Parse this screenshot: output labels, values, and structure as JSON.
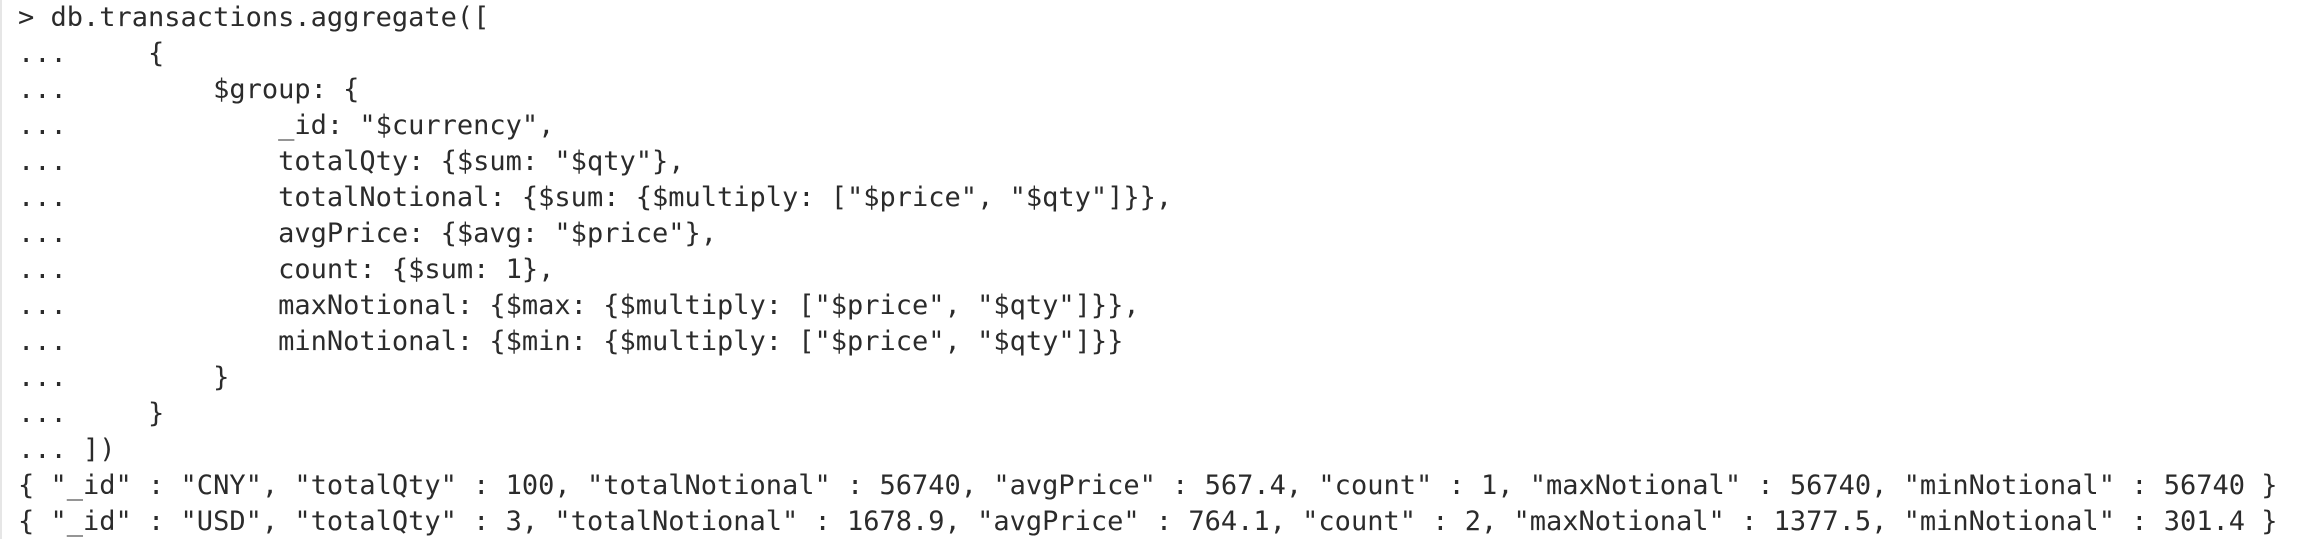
{
  "terminal": {
    "lines": [
      "> db.transactions.aggregate([",
      "...     {",
      "...         $group: {",
      "...             _id: \"$currency\",",
      "...             totalQty: {$sum: \"$qty\"},",
      "...             totalNotional: {$sum: {$multiply: [\"$price\", \"$qty\"]}},",
      "...             avgPrice: {$avg: \"$price\"},",
      "...             count: {$sum: 1},",
      "...             maxNotional: {$max: {$multiply: [\"$price\", \"$qty\"]}},",
      "...             minNotional: {$min: {$multiply: [\"$price\", \"$qty\"]}}",
      "...         }",
      "...     }",
      "... ])",
      "{ \"_id\" : \"CNY\", \"totalQty\" : 100, \"totalNotional\" : 56740, \"avgPrice\" : 567.4, \"count\" : 1, \"maxNotional\" : 56740, \"minNotional\" : 56740 }",
      "{ \"_id\" : \"USD\", \"totalQty\" : 3, \"totalNotional\" : 1678.9, \"avgPrice\" : 764.1, \"count\" : 2, \"maxNotional\" : 1377.5, \"minNotional\" : 301.4 }"
    ]
  },
  "colors": {
    "background": "#ffffff",
    "text": "#2b2b2b"
  }
}
